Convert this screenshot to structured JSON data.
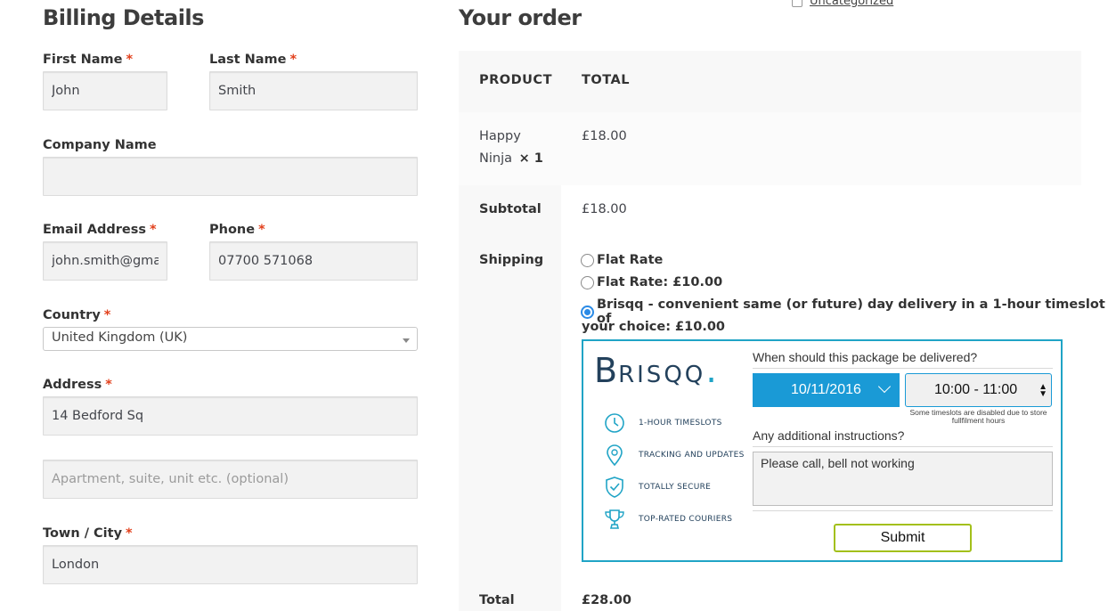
{
  "top": {
    "category_link": "Uncategorized"
  },
  "billing": {
    "title": "Billing Details",
    "required_mark": "*",
    "first_name": {
      "label": "First Name",
      "value": "John"
    },
    "last_name": {
      "label": "Last Name",
      "value": "Smith"
    },
    "company": {
      "label": "Company Name",
      "value": ""
    },
    "email": {
      "label": "Email Address",
      "value": "john.smith@gmail"
    },
    "phone": {
      "label": "Phone",
      "value": "07700 571068"
    },
    "country": {
      "label": "Country",
      "value": "United Kingdom (UK)"
    },
    "address": {
      "label": "Address",
      "value": "14 Bedford Sq",
      "placeholder2": "Apartment, suite, unit etc. (optional)"
    },
    "city": {
      "label": "Town / City",
      "value": "London"
    }
  },
  "order": {
    "title": "Your order",
    "col_product": "PRODUCT",
    "col_total": "TOTAL",
    "item": {
      "name_line1": "Happy",
      "name_line2": "Ninja",
      "qty": "× 1",
      "total": "£18.00"
    },
    "subtotal_label": "Subtotal",
    "subtotal_value": "£18.00",
    "shipping_label": "Shipping",
    "shipping_options": [
      {
        "label": "Flat Rate",
        "selected": false
      },
      {
        "label": "Flat Rate: £10.00",
        "selected": false
      },
      {
        "label": "Brisqq - convenient same (or future) day delivery in a 1-hour timeslot of",
        "label_cont": "your choice: £10.00",
        "selected": true
      }
    ],
    "total_label": "Total",
    "total_value": "£28.00"
  },
  "brisqq": {
    "logo_b": "B",
    "logo_rest": "RISQQ",
    "logo_dot": ".",
    "features": [
      "1-HOUR TIMESLOTS",
      "TRACKING AND UPDATES",
      "TOTALLY SECURE",
      "TOP-RATED COURIERS"
    ],
    "question": "When should this package be delivered?",
    "date": "10/11/2016",
    "time": "10:00 - 11:00",
    "note": "Some timeslots are disabled due to store fullfilment hours",
    "instructions_label": "Any additional instructions?",
    "instructions_value": "Please call, bell not working",
    "submit_label": "Submit",
    "accent": "#20a4c6",
    "date_bg": "#1a9ad6",
    "submit_border": "#a3c01a"
  }
}
